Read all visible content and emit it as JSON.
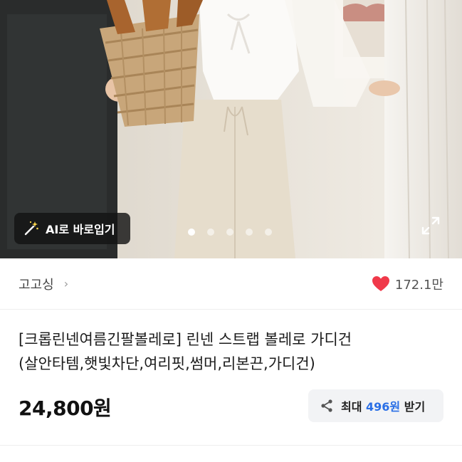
{
  "hero": {
    "ai_button_label": "AI로 바로입기",
    "slide_count": 5,
    "active_slide": 1
  },
  "seller": {
    "name": "고고싱",
    "chevron": "›"
  },
  "like": {
    "count": "172.1만",
    "color": "#f0394a"
  },
  "product": {
    "title_line1": "[크롭린넨여름긴팔볼레로] 린넨 스트랩 볼레로 가디건",
    "title_line2": "(살안타템,햇빛차단,여리핏,썸머,리본끈,가디건)",
    "price": "24,800원"
  },
  "reward": {
    "prefix": "최대",
    "amount": "496원",
    "suffix": "받기",
    "accent": "#2a6fe6"
  },
  "icons": {
    "wand": "magic-wand-icon",
    "expand": "expand-icon",
    "heart": "heart-icon",
    "share": "share-icon"
  }
}
